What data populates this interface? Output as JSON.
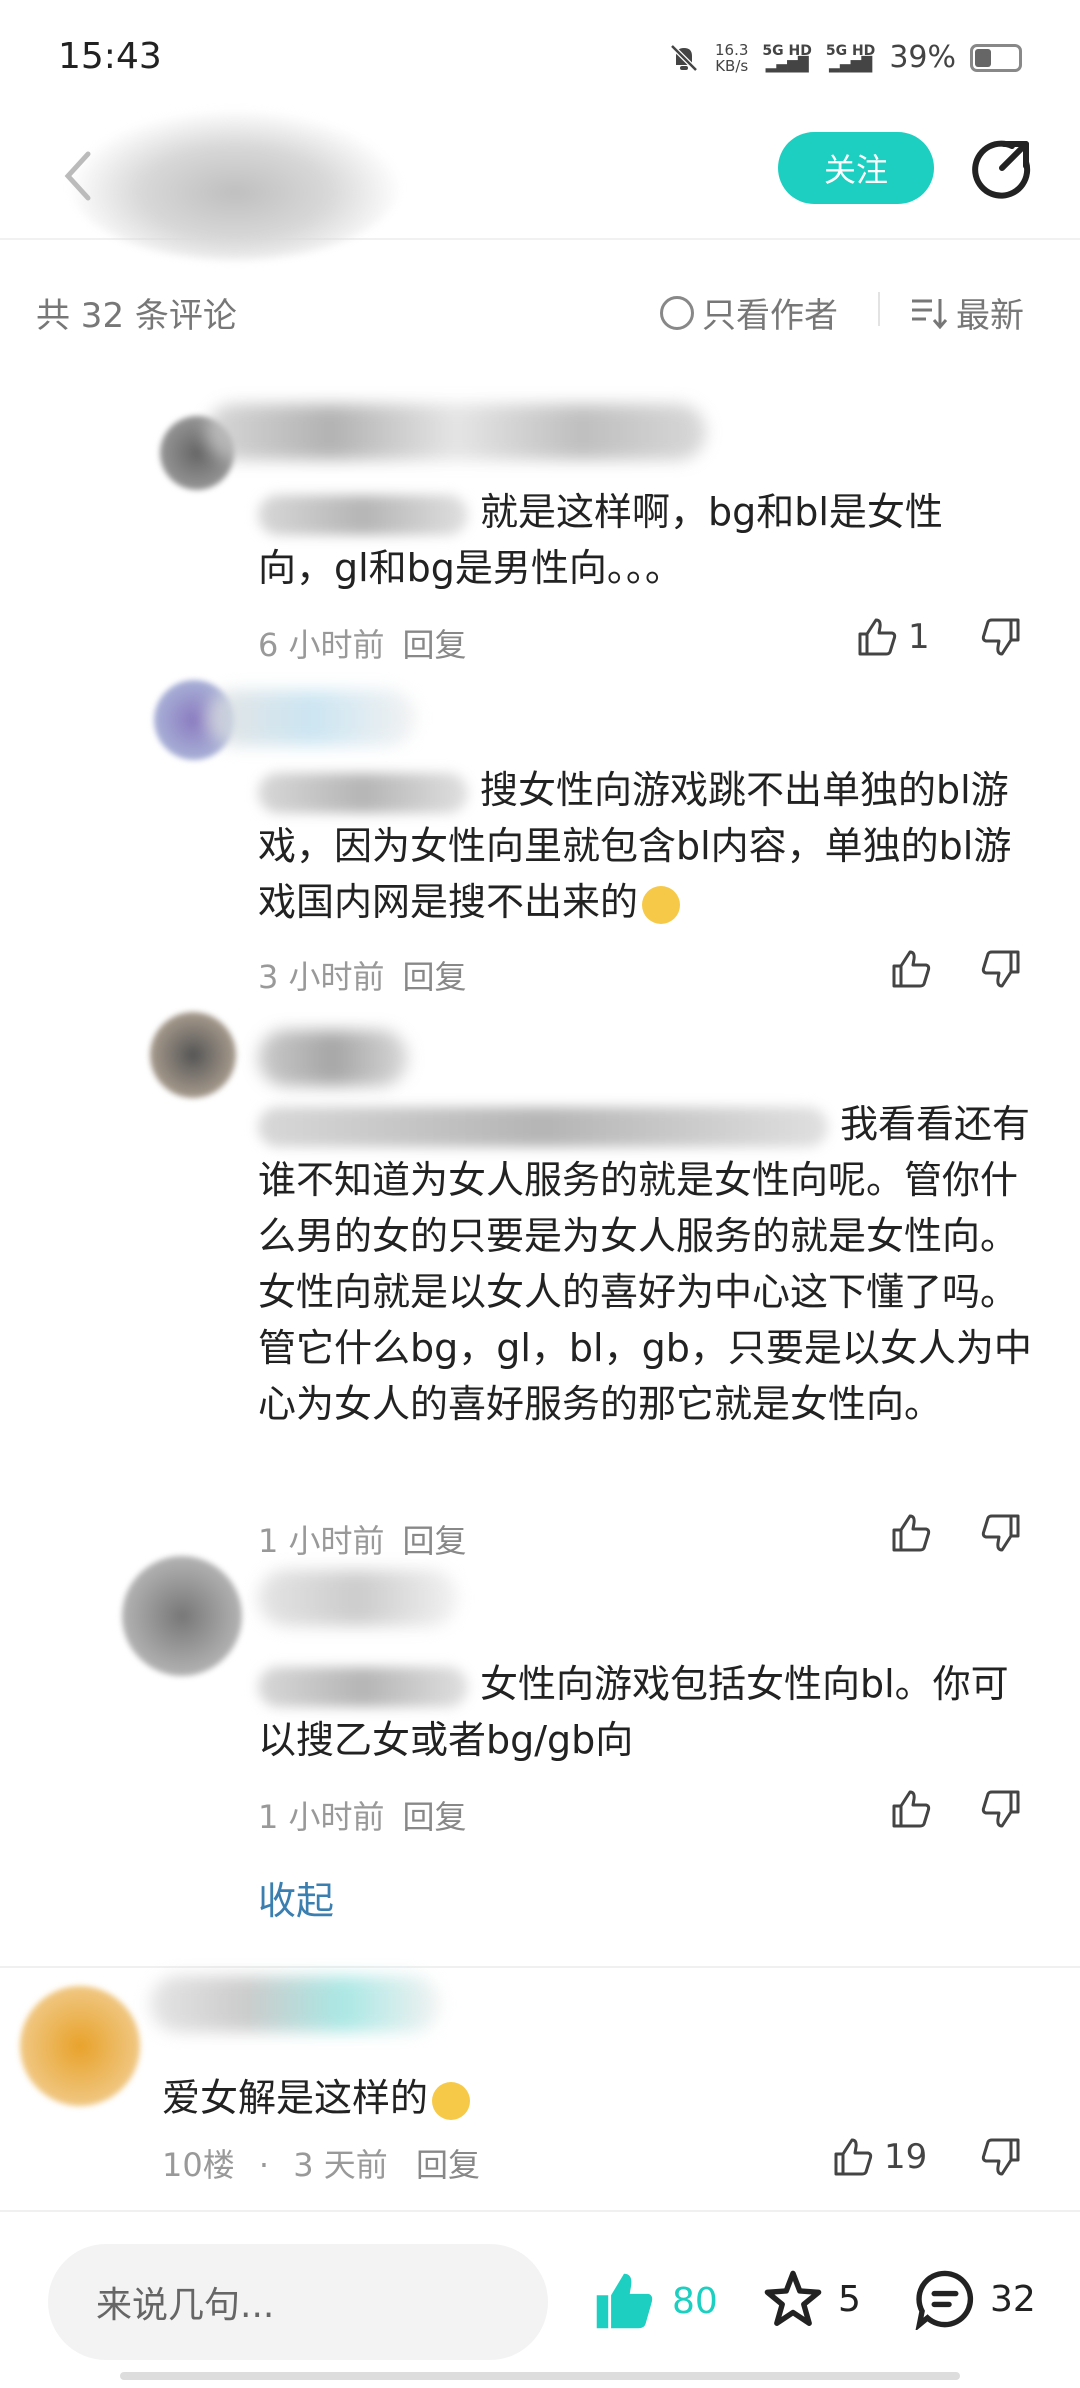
{
  "status_bar": {
    "time": "15:43",
    "net_speed": "16.3",
    "net_unit": "KB/s",
    "signal1": "5G HD",
    "signal2": "5G HD",
    "battery": "39%"
  },
  "header": {
    "follow_label": "关注"
  },
  "comments_bar": {
    "count_label": "共 32 条评论",
    "author_only_label": "只看作者",
    "sort_label": "最新"
  },
  "replies": [
    {
      "text": "就是这样啊，bg和bl是女性向，gl和bg是男性向。。。",
      "time": "6 小时前",
      "reply_label": "回复",
      "likes": "1"
    },
    {
      "text": "搜女性向游戏跳不出单独的bl游戏，因为女性向里就包含bl内容，单独的bl游戏国内网是搜不出来的",
      "time": "3 小时前",
      "reply_label": "回复",
      "likes": ""
    },
    {
      "text": "我看看还有谁不知道为女人服务的就是女性向呢。管你什么男的女的只要是为女人服务的就是女性向。女性向就是以女人的喜好为中心这下懂了吗。管它什么bg，gl，bl，gb，只要是以女人为中心为女人的喜好服务的那它就是女性向。",
      "time": "1 小时前",
      "reply_label": "回复",
      "likes": ""
    },
    {
      "text": "女性向游戏包括女性向bl。你可以搜乙女或者bg/gb向",
      "time": "1 小时前",
      "reply_label": "回复",
      "likes": ""
    }
  ],
  "collapse_label": "收起",
  "floor_comment": {
    "text": "爱女解是这样的",
    "floor": "10楼",
    "dot": "·",
    "time": "3 天前",
    "reply_label": "回复",
    "likes": "19"
  },
  "bottom_bar": {
    "input_placeholder": "来说几句...",
    "likes": "80",
    "favorites": "5",
    "comments": "32"
  },
  "colors": {
    "accent": "#1dcfc0",
    "link": "#3a7fb0"
  }
}
